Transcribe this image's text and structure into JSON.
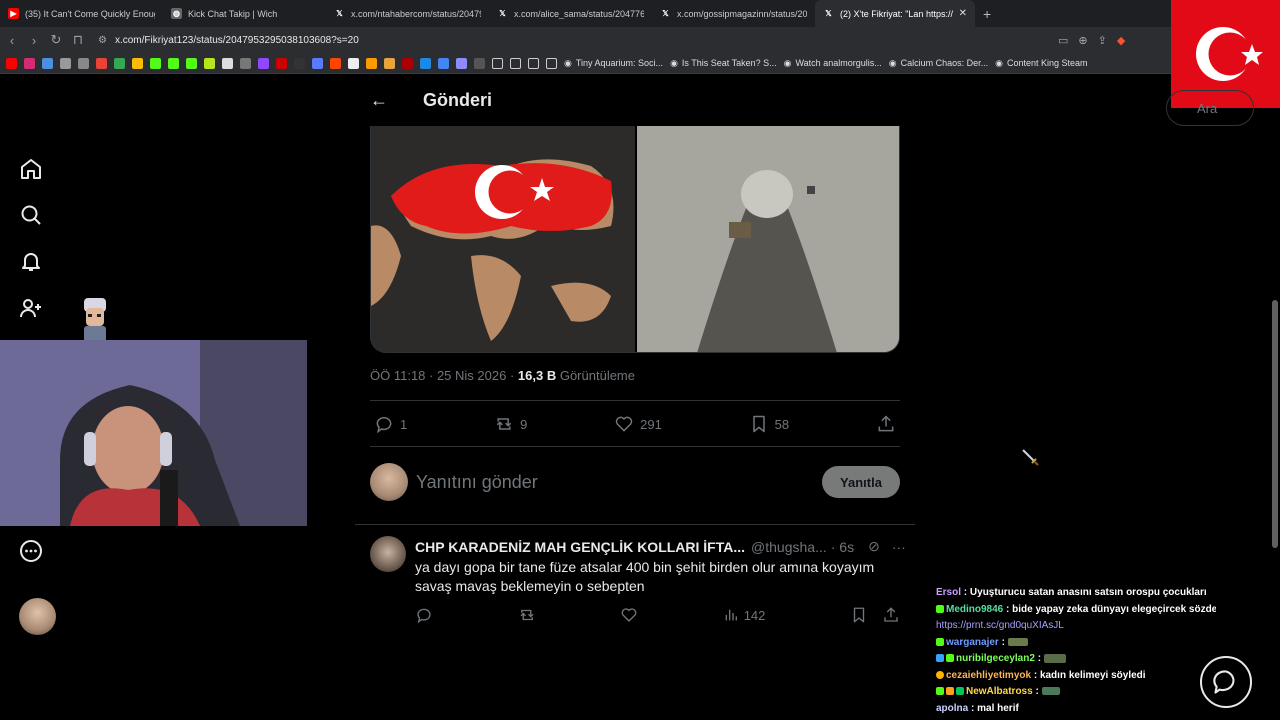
{
  "browser": {
    "tabs": [
      {
        "label": "(35) It Can't Come Quickly Enough -",
        "icon": "youtube-icon",
        "color": "#ff0000"
      },
      {
        "label": "Kick Chat Takip | Wich",
        "icon": "globe-icon",
        "color": "#888888"
      },
      {
        "label": "x.com/ntahabercom/status/204795",
        "icon": "x-icon",
        "color": "#000000"
      },
      {
        "label": "x.com/alice_sama/status/20477689",
        "icon": "x-icon",
        "color": "#000000"
      },
      {
        "label": "x.com/gossipmagazinn/status/2047",
        "icon": "x-icon",
        "color": "#000000"
      },
      {
        "label": "(2) X'te Fikriyat: \"Lan https://t",
        "icon": "x-icon",
        "color": "#000000",
        "active": true
      }
    ],
    "url": "x.com/Fikriyat123/status/2047953295038103608?s=20",
    "bookmarks": [
      "Tiny Aquarium: Soci...",
      "Is This Seat Taken? S...",
      "Watch analmorgulis...",
      "Calcium Chaos: Der...",
      "Content King Steam"
    ]
  },
  "header": {
    "title": "Gönderi"
  },
  "tweet": {
    "meta_time": "ÖÖ 11:18 · 25 Nis 2026 ·",
    "views": "16,3 B",
    "views_label": "Görüntüleme",
    "replies": "1",
    "retweets": "9",
    "likes": "291",
    "bookmarks": "58"
  },
  "compose": {
    "placeholder": "Yanıtını gönder",
    "button": "Yanıtla"
  },
  "reply": {
    "name": "CHP KARADENİZ MAH GENÇLİK KOLLARI İFTA...",
    "handle": "@thugsha...",
    "time": "· 6s",
    "text": "ya dayı gopa bir tane füze atsalar 400 bin şehit birden olur amına koyayım savaş mavaş beklemeyin o sebepten",
    "views": "142"
  },
  "search": {
    "placeholder": "Ara"
  },
  "chat": [
    {
      "user": "Ersol",
      "msg": "Uyuşturucu satan anasını satsın orospu çocukları",
      "color": "#c9a0ff"
    },
    {
      "user": "Medino9846",
      "msg": "bide yapay zeka dünyayı elegeçircek sözde",
      "color": "#52e0a0"
    },
    {
      "user": "",
      "msg": "https://prnt.sc/gnd0quXIAsJL",
      "color": "#a3a3ff"
    },
    {
      "user": "warganajer",
      "msg": "",
      "color": "#6f9cff"
    },
    {
      "user": "nuribilgeceylan2",
      "msg": "",
      "color": "#7dff5a"
    },
    {
      "user": "cezaiehliyetimyok",
      "msg": "kadın kelimeyi söyledi",
      "color": "#ffb35a"
    },
    {
      "user": "NewAlbatross",
      "msg": "",
      "color": "#ffd84a"
    },
    {
      "user": "apolna",
      "msg": "mal herif",
      "color": "#c9d1ff"
    }
  ]
}
